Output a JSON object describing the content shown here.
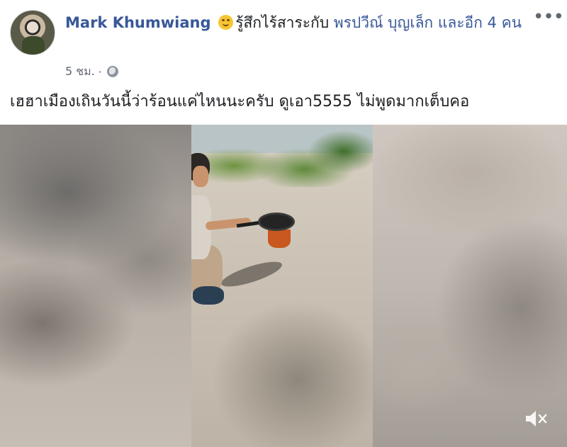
{
  "post": {
    "author": "Mark Khumwiang",
    "feeling_text": "รู้สึกไร้สาระกับ",
    "tagged_person": "พรปวีณ์ บุญเล็ก",
    "tagged_others": "และอีก 4 คน",
    "timestamp": "5 ชม.",
    "separator": "·",
    "privacy_icon": "globe-icon",
    "more_label": "•••",
    "text": "เฮฮาเมืองเถินวันนี้ว่าร้อนแค่ไหนนะครับ ดูเอา5555 ไม่พูดมากเต็บคอ"
  },
  "video": {
    "volume_icon": "speaker-muted-icon"
  },
  "colors": {
    "link": "#385898",
    "meta": "#606770",
    "text": "#1c1e21"
  }
}
